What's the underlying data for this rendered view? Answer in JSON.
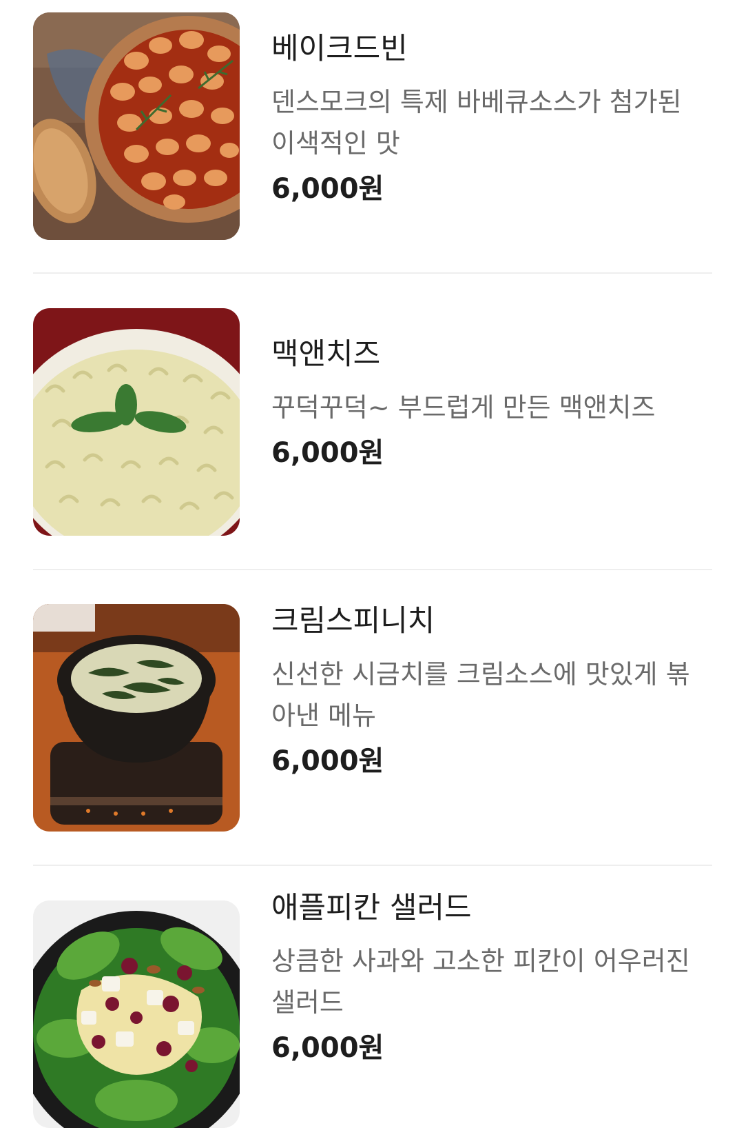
{
  "menu": {
    "items": [
      {
        "name": "베이크드빈",
        "description": "덴스모크의 특제 바베큐소스가 첨가된 이색적인 맛",
        "price": "6,000원",
        "image_icon": "baked-beans-photo"
      },
      {
        "name": "맥앤치즈",
        "description": "꾸덕꾸덕~ 부드럽게 만든 맥앤치즈",
        "price": "6,000원",
        "image_icon": "mac-and-cheese-photo"
      },
      {
        "name": "크림스피니치",
        "description": "신선한 시금치를 크림소스에 맛있게 볶아낸 메뉴",
        "price": "6,000원",
        "image_icon": "creamed-spinach-photo"
      },
      {
        "name": "애플피칸 샐러드",
        "description": "상큼한 사과와 고소한 피칸이 어우러진 샐러드",
        "price": "6,000원",
        "image_icon": "apple-pecan-salad-photo"
      }
    ]
  }
}
